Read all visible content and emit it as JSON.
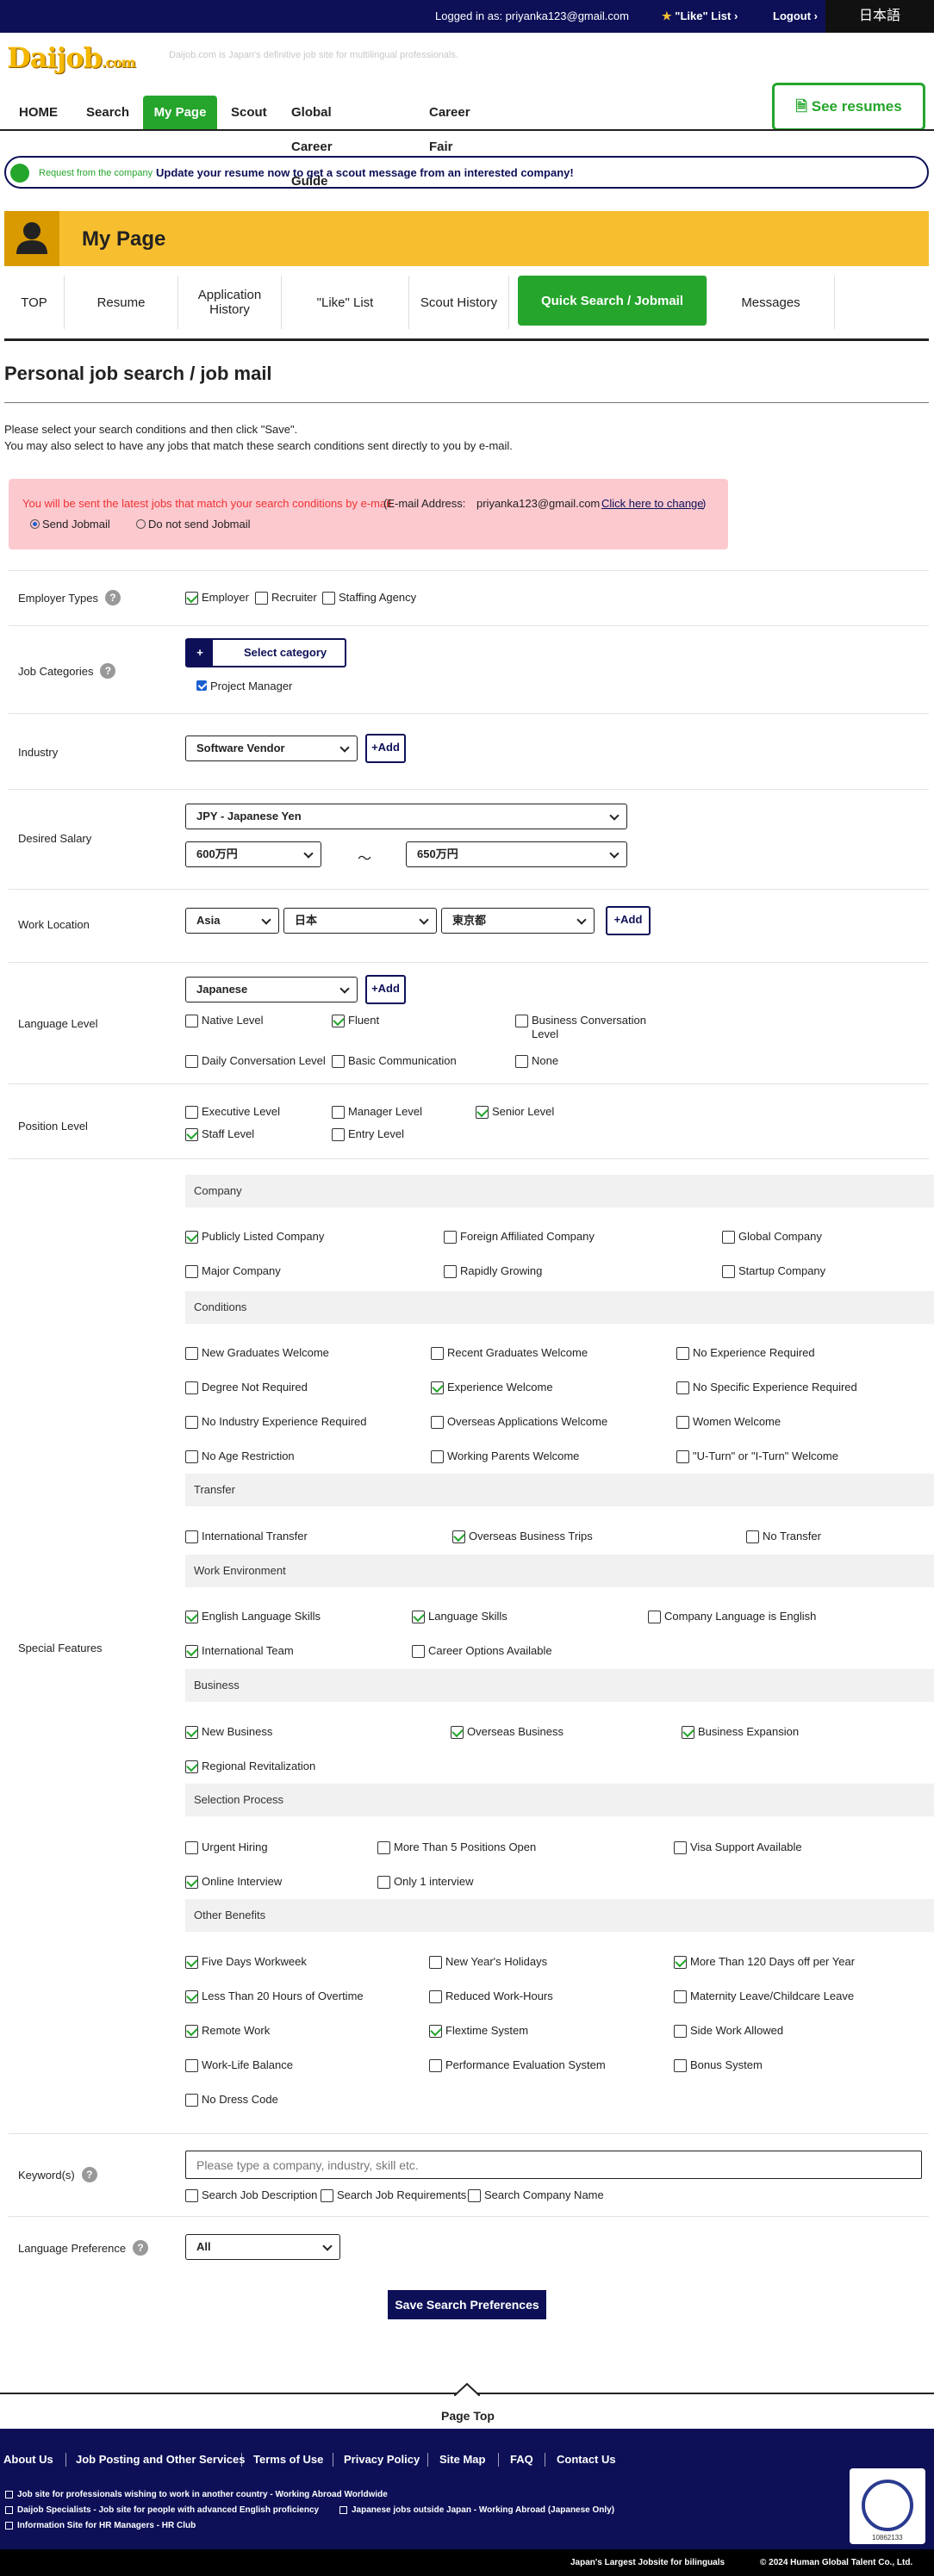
{
  "topbar": {
    "logged_in": "Logged in as: priyanka123@gmail.com",
    "like_list": "\"Like\" List ›",
    "logout": "Logout ›",
    "language": "日本語"
  },
  "header": {
    "logo_main": "Daijob",
    "logo_suffix": ".com",
    "tagline": "Daijob.com is Japan's definitive job site for multilingual professionals.",
    "see_resumes": "See resumes"
  },
  "nav": [
    {
      "label": "HOME",
      "active": false
    },
    {
      "label": "Search",
      "active": false
    },
    {
      "label": "My Page",
      "active": true
    },
    {
      "label": "Scout",
      "active": false
    },
    {
      "label": "Global Career Guide",
      "active": false
    },
    {
      "label": "Career Fair",
      "active": false
    }
  ],
  "banner": {
    "label": "Request from the company",
    "message": "Update your resume now to get a scout message from an interested company!"
  },
  "mypage": {
    "title": "My Page",
    "tabs": [
      {
        "label": "TOP",
        "active": false
      },
      {
        "label": "Resume",
        "active": false
      },
      {
        "label": "Application History",
        "active": false
      },
      {
        "label": "\"Like\" List",
        "active": false
      },
      {
        "label": "Scout History",
        "active": false
      },
      {
        "label": "Quick Search / Jobmail",
        "active": true
      },
      {
        "label": "Messages",
        "active": false
      }
    ]
  },
  "page": {
    "title": "Personal job search / job mail",
    "intro1": "Please select your search conditions and then click \"Save\".",
    "intro2": "You may also select to have any jobs that match these search conditions sent directly to you by e-mail."
  },
  "jobmail": {
    "notice": "You will be sent the latest jobs that match your search conditions by e-mail.",
    "email_label": "(E-mail Address:",
    "email": "priyanka123@gmail.com",
    "change_link": "Click here to change",
    "close_paren": ")",
    "send": "Send Jobmail",
    "no_send": "Do not send Jobmail"
  },
  "form": {
    "employer_types": {
      "label": "Employer Types",
      "options": [
        {
          "label": "Employer",
          "checked": true
        },
        {
          "label": "Recruiter",
          "checked": false
        },
        {
          "label": "Staffing Agency",
          "checked": false
        }
      ]
    },
    "job_categories": {
      "label": "Job Categories",
      "button_symbol": "+",
      "button": "Select category",
      "selected": "Project Manager"
    },
    "industry": {
      "label": "Industry",
      "value": "Software Vendor",
      "add": "+Add"
    },
    "salary": {
      "label": "Desired Salary",
      "currency": "JPY - Japanese Yen",
      "min": "600万円",
      "tilde": "～",
      "max": "650万円"
    },
    "location": {
      "label": "Work Location",
      "region": "Asia",
      "country": "日本",
      "prefecture": "東京都",
      "add": "+Add"
    },
    "language": {
      "label": "Language Level",
      "value": "Japanese",
      "add": "+Add",
      "levels": [
        {
          "label": "Native Level",
          "checked": false
        },
        {
          "label": "Fluent",
          "checked": true
        },
        {
          "label": "Business Conversation Level",
          "checked": false
        },
        {
          "label": "Daily Conversation Level",
          "checked": false
        },
        {
          "label": "Basic Communication",
          "checked": false
        },
        {
          "label": "None",
          "checked": false
        }
      ]
    },
    "position": {
      "label": "Position Level",
      "levels": [
        {
          "label": "Executive Level",
          "checked": false
        },
        {
          "label": "Manager Level",
          "checked": false
        },
        {
          "label": "Senior Level",
          "checked": true
        },
        {
          "label": "Staff Level",
          "checked": true
        },
        {
          "label": "Entry Level",
          "checked": false
        }
      ]
    },
    "special": {
      "label": "Special Features",
      "groups": [
        {
          "title": "Company",
          "items": [
            {
              "label": "Publicly Listed Company",
              "checked": true
            },
            {
              "label": "Foreign Affiliated Company",
              "checked": false
            },
            {
              "label": "Global Company",
              "checked": false
            },
            {
              "label": "Major Company",
              "checked": false
            },
            {
              "label": "Rapidly Growing",
              "checked": false
            },
            {
              "label": "Startup Company",
              "checked": false
            }
          ]
        },
        {
          "title": "Conditions",
          "items": [
            {
              "label": "New Graduates Welcome",
              "checked": false
            },
            {
              "label": "Recent Graduates Welcome",
              "checked": false
            },
            {
              "label": "No Experience Required",
              "checked": false
            },
            {
              "label": "Degree Not Required",
              "checked": false
            },
            {
              "label": "Experience Welcome",
              "checked": true
            },
            {
              "label": "No Specific Experience Required",
              "checked": false
            },
            {
              "label": "No Industry Experience Required",
              "checked": false
            },
            {
              "label": "Overseas Applications Welcome",
              "checked": false
            },
            {
              "label": "Women Welcome",
              "checked": false
            },
            {
              "label": "No Age Restriction",
              "checked": false
            },
            {
              "label": "Working Parents Welcome",
              "checked": false
            },
            {
              "label": "\"U-Turn\" or \"I-Turn\" Welcome",
              "checked": false
            }
          ]
        },
        {
          "title": "Transfer",
          "items": [
            {
              "label": "International Transfer",
              "checked": false
            },
            {
              "label": "Overseas Business Trips",
              "checked": true
            },
            {
              "label": "No Transfer",
              "checked": false
            }
          ]
        },
        {
          "title": "Work Environment",
          "items": [
            {
              "label": "English Language Skills",
              "checked": true
            },
            {
              "label": "Language Skills",
              "checked": true
            },
            {
              "label": "Company Language is English",
              "checked": false
            },
            {
              "label": "International Team",
              "checked": true
            },
            {
              "label": "Career Options Available",
              "checked": false
            }
          ]
        },
        {
          "title": "Business",
          "items": [
            {
              "label": "New Business",
              "checked": true
            },
            {
              "label": "Overseas Business",
              "checked": true
            },
            {
              "label": "Business Expansion",
              "checked": true
            },
            {
              "label": "Regional Revitalization",
              "checked": true
            }
          ]
        },
        {
          "title": "Selection Process",
          "items": [
            {
              "label": "Urgent Hiring",
              "checked": false
            },
            {
              "label": "More Than 5 Positions Open",
              "checked": false
            },
            {
              "label": "Visa Support Available",
              "checked": false
            },
            {
              "label": "Online Interview",
              "checked": true
            },
            {
              "label": "Only 1 interview",
              "checked": false
            }
          ]
        },
        {
          "title": "Other Benefits",
          "items": [
            {
              "label": "Five Days Workweek",
              "checked": true
            },
            {
              "label": "New Year's Holidays",
              "checked": false
            },
            {
              "label": "More Than 120 Days off per Year",
              "checked": true
            },
            {
              "label": "Less Than 20 Hours of Overtime",
              "checked": true
            },
            {
              "label": "Reduced Work-Hours",
              "checked": false
            },
            {
              "label": "Maternity Leave/Childcare Leave",
              "checked": false
            },
            {
              "label": "Remote Work",
              "checked": true
            },
            {
              "label": "Flextime System",
              "checked": true
            },
            {
              "label": "Side Work Allowed",
              "checked": false
            },
            {
              "label": "Work-Life Balance",
              "checked": false
            },
            {
              "label": "Performance Evaluation System",
              "checked": false
            },
            {
              "label": "Bonus System",
              "checked": false
            },
            {
              "label": "No Dress Code",
              "checked": false
            }
          ]
        }
      ]
    },
    "keywords": {
      "label": "Keyword(s)",
      "placeholder": "Please type a company, industry, skill etc.",
      "options": [
        {
          "label": "Search Job Description",
          "checked": false
        },
        {
          "label": "Search Job Requirements",
          "checked": false
        },
        {
          "label": "Search Company Name",
          "checked": false
        }
      ]
    },
    "language_pref": {
      "label": "Language Preference",
      "value": "All"
    },
    "help_symbol": "?",
    "save": "Save Search Preferences"
  },
  "footer": {
    "page_top": "Page Top",
    "links": [
      "About Us",
      "Job Posting and Other Services",
      "Terms of Use",
      "Privacy Policy",
      "Site Map",
      "FAQ",
      "Contact Us"
    ],
    "sites": [
      "Job site for professionals wishing to work in another country - Working Abroad Worldwide",
      "Daijob Specialists - Job site for people with advanced English proficiency",
      "Japanese jobs outside Japan - Working Abroad (Japanese Only)",
      "Information Site for HR Managers - HR Club"
    ],
    "privacy_number": "10862133",
    "tagline": "Japan's Largest Jobsite for bilinguals",
    "copyright": "© 2024 Human Global Talent Co., Ltd."
  },
  "colors": {
    "navy": "#0d1057",
    "green": "#25a52c",
    "yellow": "#f7bf30"
  }
}
